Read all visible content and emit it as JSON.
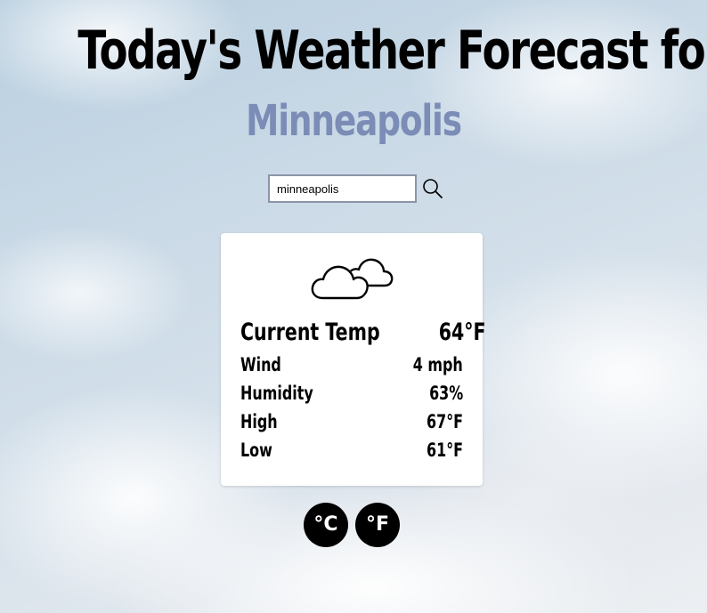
{
  "header": {
    "title": "Today's Weather Forecast for",
    "city": "Minneapolis",
    "city_color": "#7b8cb6"
  },
  "search": {
    "value": "minneapolis",
    "button_icon": "search-icon"
  },
  "weather": {
    "condition_icon": "cloudy-icon",
    "current_label": "Current Temp",
    "current_value": "64°F",
    "rows": [
      {
        "label": "Wind",
        "value": "4 mph"
      },
      {
        "label": "Humidity",
        "value": "63%"
      },
      {
        "label": "High",
        "value": "67°F"
      },
      {
        "label": "Low",
        "value": "61°F"
      }
    ]
  },
  "units": {
    "celsius_label": "°C",
    "fahrenheit_label": "°F"
  }
}
